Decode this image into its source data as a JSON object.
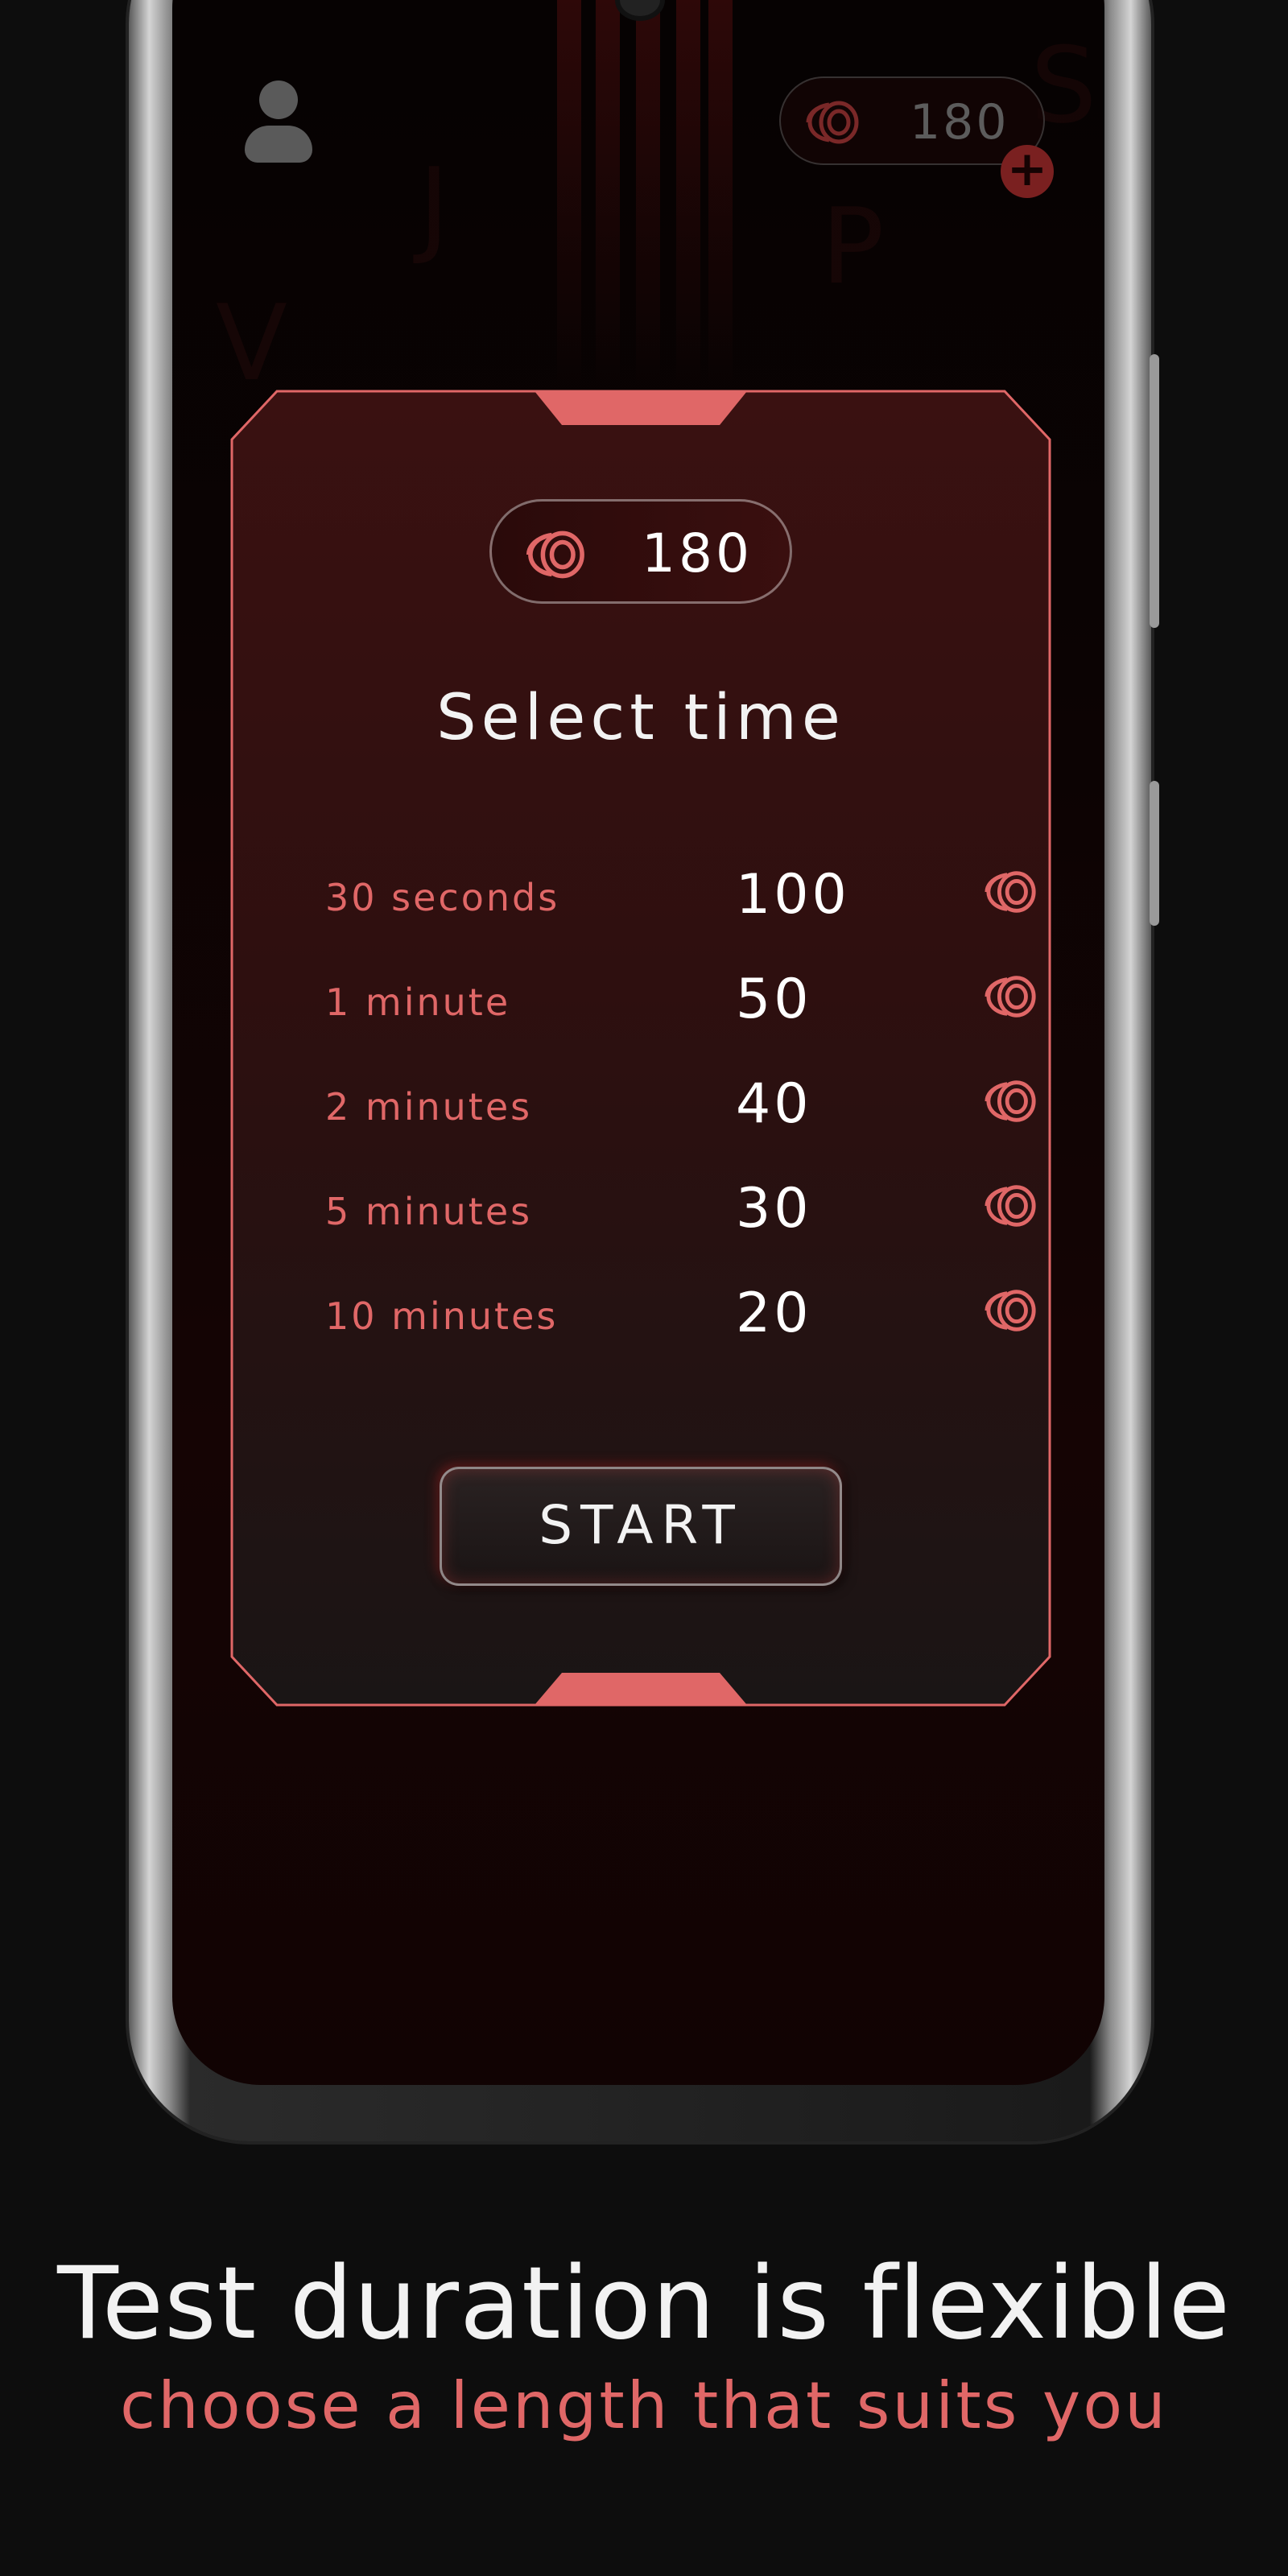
{
  "top_bar": {
    "coin_balance": "180",
    "add_coins_symbol": "+"
  },
  "modal": {
    "balance": "180",
    "title": "Select time",
    "options": [
      {
        "label": "30 seconds",
        "cost": "100"
      },
      {
        "label": "1 minute",
        "cost": "50"
      },
      {
        "label": "2 minutes",
        "cost": "40"
      },
      {
        "label": "5 minutes",
        "cost": "30"
      },
      {
        "label": "10 minutes",
        "cost": "20"
      }
    ],
    "start_label": "START"
  },
  "caption": {
    "title": "Test duration is flexible",
    "subtitle": "choose a length that suits you"
  },
  "colors": {
    "accent": "#e06767",
    "panel": "#3a1212",
    "background": "#0d0d0d"
  },
  "icons": {
    "coin": "coin-stack-icon",
    "avatar": "user-icon",
    "add": "plus-icon"
  }
}
